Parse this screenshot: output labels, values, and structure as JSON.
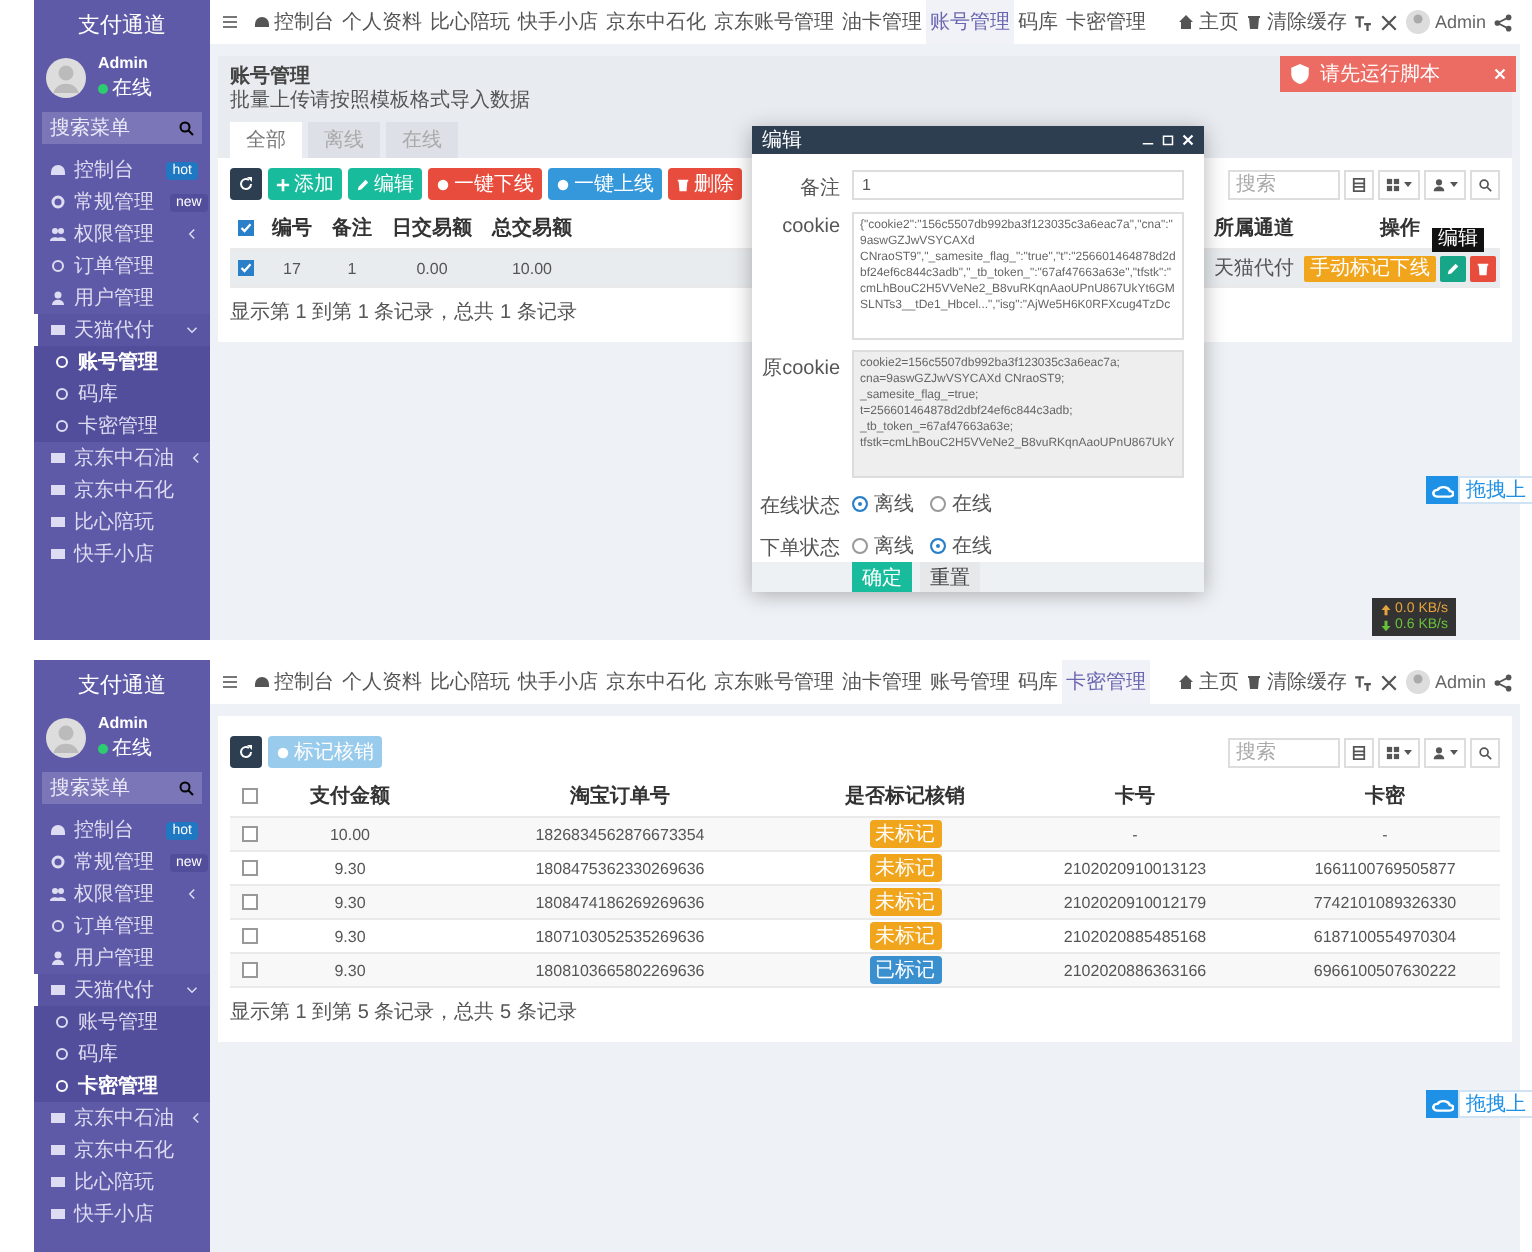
{
  "top_screen": {
    "sidebar": {
      "title": "支付通道",
      "user": "Admin",
      "status": "在线",
      "search_placeholder": "搜索菜单",
      "items": [
        {
          "label": "控制台",
          "selected": false,
          "badge": {
            "text": "hot",
            "kind": "hot"
          }
        },
        {
          "label": "常规管理",
          "selected": false,
          "badge": {
            "text": "new",
            "kind": "new"
          }
        },
        {
          "label": "权限管理",
          "selected": false,
          "expanded": false
        },
        {
          "label": "订单管理",
          "selected": false
        },
        {
          "label": "用户管理",
          "selected": false
        },
        {
          "label": "天猫代付",
          "selected": false,
          "expanded": true,
          "children": [
            {
              "label": "账号管理",
              "selected": true
            },
            {
              "label": "码库",
              "selected": false
            },
            {
              "label": "卡密管理",
              "selected": false
            }
          ]
        },
        {
          "label": "京东中石油",
          "selected": false,
          "expanded": false
        },
        {
          "label": "京东中石化",
          "selected": false
        },
        {
          "label": "比心陪玩",
          "selected": false
        },
        {
          "label": "快手小店",
          "selected": false
        }
      ]
    },
    "navbar": {
      "tabs": [
        {
          "label": "控制台",
          "selected": false
        },
        {
          "label": "个人资料",
          "selected": false
        },
        {
          "label": "比心陪玩",
          "selected": false
        },
        {
          "label": "快手小店",
          "selected": false
        },
        {
          "label": "京东中石化",
          "selected": false
        },
        {
          "label": "京东账号管理",
          "selected": false
        },
        {
          "label": "油卡管理",
          "selected": false
        },
        {
          "label": "账号管理",
          "selected": true
        },
        {
          "label": "码库",
          "selected": false
        },
        {
          "label": "卡密管理",
          "selected": false
        }
      ],
      "home": "主页",
      "clear_cache": "清除缓存",
      "user": "Admin"
    },
    "page_title": "账号管理",
    "page_subtitle": "批量上传请按照模板格式导入数据",
    "filter_tabs": [
      {
        "label": "全部",
        "selected": true
      },
      {
        "label": "离线",
        "selected": false
      },
      {
        "label": "在线",
        "selected": false
      }
    ],
    "toolbar": [
      {
        "kind": "refresh"
      },
      {
        "kind": "add",
        "label": "添加"
      },
      {
        "kind": "edit",
        "label": "编辑"
      },
      {
        "kind": "offline",
        "label": "一键下线"
      },
      {
        "kind": "online",
        "label": "一键上线"
      },
      {
        "kind": "delete",
        "label": "删除"
      }
    ],
    "search_placeholder": "搜索",
    "table": {
      "all_checked": true,
      "columns": [
        "编号",
        "备注",
        "日交易额",
        "总交易额",
        "所属通道",
        "操作"
      ],
      "rows": [
        {
          "checked": true,
          "cells": [
            "17",
            "1",
            "0.00",
            "10.00",
            "天猫代付"
          ],
          "action_label": "手动标记下线"
        }
      ]
    },
    "tooltip": "编辑",
    "footer": "显示第 1 到第 1 条记录，总共 1 条记录",
    "alert": "请先运行脚本",
    "modal": {
      "title": "编辑",
      "remark_label": "备注",
      "remark": "1",
      "cookie_label": "cookie",
      "cookie": "{\"cookie2\":\"156c5507db992ba3f123035c3a6eac7a\",\"cna\":\"9aswGZJwVSYCAXd CNraoST9\",\"_samesite_flag_\":\"true\",\"t\":\"256601464878d2dbf24ef6c844c3adb\",\"_tb_token_\":\"67af47663a63e\",\"tfstk\":\"cmLhBouC2H5VVeNe2_B8vuRKqnAaoUPnU867UkYt6GMSLNTs3__tDe1_Hbcel...\",\"isg\":\"AjWe5H6K0RFXcug4TzDc",
      "original_cookie_label": "原cookie",
      "original_cookie": "cookie2=156c5507db992ba3f123035c3a6eac7a; cna=9aswGZJwVSYCAXd CNraoST9; _samesite_flag_=true; t=256601464878d2dbf24ef6c844c3adb; _tb_token_=67af47663a63e; tfstk=cmLhBouC2H5VVeNe2_B8vuRKqnAaoUPnU867UkY",
      "radio_groups": [
        {
          "label": "在线状态",
          "options": [
            {
              "label": "离线",
              "selected": true
            },
            {
              "label": "在线",
              "selected": false
            }
          ]
        },
        {
          "label": "下单状态",
          "options": [
            {
              "label": "离线",
              "selected": false
            },
            {
              "label": "在线",
              "selected": true
            }
          ]
        }
      ],
      "buttons": [
        {
          "kind": "primary",
          "label": "确定"
        },
        {
          "kind": "default",
          "label": "重置"
        }
      ]
    },
    "upload": "拖拽上",
    "speed": {
      "up": "0.0 KB/s",
      "down": "0.6 KB/s"
    }
  },
  "bottom_screen": {
    "sidebar": {
      "title": "支付通道",
      "user": "Admin",
      "status": "在线",
      "search_placeholder": "搜索菜单",
      "items": [
        {
          "label": "控制台",
          "selected": false,
          "badge": {
            "text": "hot",
            "kind": "hot"
          }
        },
        {
          "label": "常规管理",
          "selected": false,
          "badge": {
            "text": "new",
            "kind": "new"
          }
        },
        {
          "label": "权限管理",
          "selected": false,
          "expanded": false
        },
        {
          "label": "订单管理",
          "selected": false
        },
        {
          "label": "用户管理",
          "selected": false
        },
        {
          "label": "天猫代付",
          "selected": false,
          "expanded": true,
          "children": [
            {
              "label": "账号管理",
              "selected": false
            },
            {
              "label": "码库",
              "selected": false
            },
            {
              "label": "卡密管理",
              "selected": true
            }
          ]
        },
        {
          "label": "京东中石油",
          "selected": false,
          "expanded": false
        },
        {
          "label": "京东中石化",
          "selected": false
        },
        {
          "label": "比心陪玩",
          "selected": false
        },
        {
          "label": "快手小店",
          "selected": false
        }
      ]
    },
    "navbar": {
      "tabs": [
        {
          "label": "控制台",
          "selected": false
        },
        {
          "label": "个人资料",
          "selected": false
        },
        {
          "label": "比心陪玩",
          "selected": false
        },
        {
          "label": "快手小店",
          "selected": false
        },
        {
          "label": "京东中石化",
          "selected": false
        },
        {
          "label": "京东账号管理",
          "selected": false
        },
        {
          "label": "油卡管理",
          "selected": false
        },
        {
          "label": "账号管理",
          "selected": false
        },
        {
          "label": "码库",
          "selected": false
        },
        {
          "label": "卡密管理",
          "selected": true
        }
      ],
      "home": "主页",
      "clear_cache": "清除缓存",
      "user": "Admin"
    },
    "toolbar": [
      {
        "kind": "refresh"
      },
      {
        "kind": "mark",
        "label": "标记核销",
        "disabled": true
      }
    ],
    "search_placeholder": "搜索",
    "table": {
      "all_checked": false,
      "columns": [
        "支付金额",
        "淘宝订单号",
        "是否标记核销",
        "卡号",
        "卡密"
      ],
      "rows": [
        {
          "checked": false,
          "amount": "10.00",
          "order": "1826834562876673354",
          "mark": {
            "label": "未标记",
            "kind": "unmarked"
          },
          "card": "-",
          "secret": "-"
        },
        {
          "checked": false,
          "amount": "9.30",
          "order": "1808475362330269636",
          "mark": {
            "label": "未标记",
            "kind": "unmarked"
          },
          "card": "2102020910013123",
          "secret": "1661100769505877"
        },
        {
          "checked": false,
          "amount": "9.30",
          "order": "1808474186269269636",
          "mark": {
            "label": "未标记",
            "kind": "unmarked"
          },
          "card": "2102020910012179",
          "secret": "7742101089326330"
        },
        {
          "checked": false,
          "amount": "9.30",
          "order": "1807103052535269636",
          "mark": {
            "label": "未标记",
            "kind": "unmarked"
          },
          "card": "2102020885485168",
          "secret": "6187100554970304"
        },
        {
          "checked": false,
          "amount": "9.30",
          "order": "1808103665802269636",
          "mark": {
            "label": "已标记",
            "kind": "marked"
          },
          "card": "2102020886363166",
          "secret": "6966100507630222"
        }
      ]
    },
    "footer": "显示第 1 到第 5 条记录，总共 5 条记录",
    "upload": "拖拽上"
  }
}
